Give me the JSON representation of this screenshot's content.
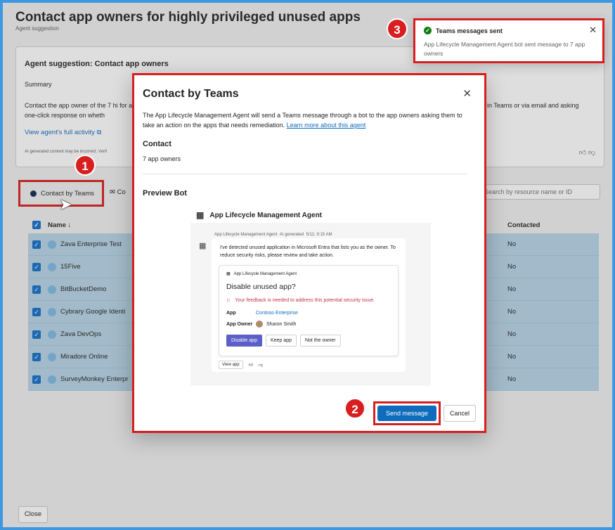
{
  "page": {
    "title": "Contact app owners for highly privileged unused apps",
    "subtitle": "Agent suggestion"
  },
  "suggestion": {
    "title": "Agent suggestion: Contact app owners",
    "summary_label": "Summary",
    "text_left": "Contact the app owner of the 7 hi for a one-click response on wheth",
    "text_right": "rs in Teams or via email and asking",
    "link": "View agent's full activity",
    "disclaimer": "AI generated content may be incorrect. Verif"
  },
  "toolbar": {
    "contact_teams": "Contact by Teams",
    "contact_other": "Co",
    "search_placeholder": "Search by resource name or ID"
  },
  "table": {
    "headers": {
      "name": "Name ↓",
      "contacted": "Contacted"
    },
    "rows": [
      {
        "name": "Zava  Enterprise Test",
        "contacted": "No"
      },
      {
        "name": "15Five",
        "contacted": "No"
      },
      {
        "name": "BitBucketDemo",
        "contacted": "No"
      },
      {
        "name": "Cybrary Google Identi",
        "contacted": "No"
      },
      {
        "name": "Zava DevOps",
        "contacted": "No"
      },
      {
        "name": "Miradore Online",
        "contacted": "No"
      },
      {
        "name": "SurveyMonkey Enterpr",
        "contacted": "No"
      }
    ]
  },
  "footer": {
    "close": "Close"
  },
  "dialog": {
    "title": "Contact by Teams",
    "description": "The App Lifecycle Management Agent will send a Teams message through a bot to the app owners asking them to take an action on the apps that needs remediation.",
    "learn_more": "Learn more about this agent",
    "contact_label": "Contact",
    "contact_value": "7 app owners",
    "preview_label": "Preview Bot",
    "send": "Send message",
    "cancel": "Cancel"
  },
  "preview": {
    "bot_name": "App Lifecycle Management Agent",
    "meta_sender": "App Lifecycle Management Agent",
    "meta_tag": "AI generated",
    "meta_time": "5/12, 9:15 AM",
    "message": "I've detected unused application in Microsoft Entra that lists you as the owner. To reduce security risks, please review and take action.",
    "card": {
      "header": "App Lifecycle Management Agent",
      "title": "Disable unused app?",
      "warning": "Your feedback is needed to address this potential security issue.",
      "app_key": "App",
      "app_value": "Contoso Enterprise",
      "owner_key": "App Owner",
      "owner_value": "Sharon Smith",
      "btn_disable": "Disable app",
      "btn_keep": "Keep app",
      "btn_not_owner": "Not the owner"
    },
    "view_app": "View app"
  },
  "toast": {
    "title": "Teams messages sent",
    "body": "App Lifecycle Management Agent bot sent message to 7 app owners"
  },
  "steps": {
    "one": "1",
    "two": "2",
    "three": "3"
  },
  "colors": {
    "highlight": "#d81e1e",
    "primary": "#0f6cbd",
    "row_selected": "#b6d4e6"
  }
}
